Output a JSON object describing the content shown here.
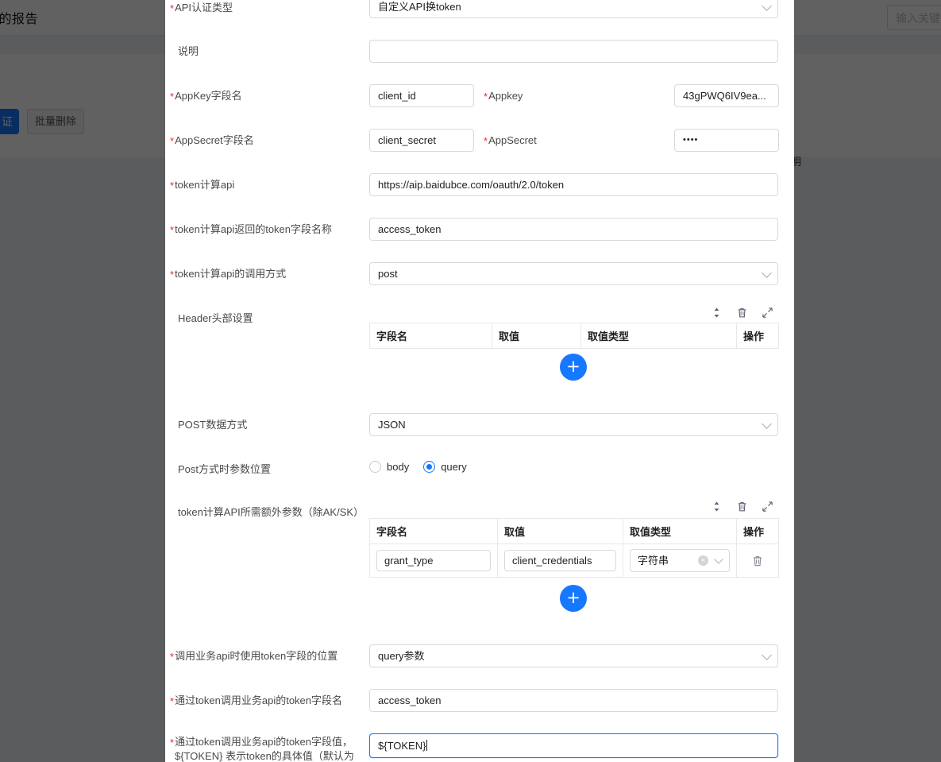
{
  "background": {
    "page_title": "我的报告",
    "search_placeholder": "输入关键词",
    "primary_button": "证",
    "secondary_button": "批量删除",
    "right_text": "明"
  },
  "modal": {
    "fields": [
      {
        "label": "API认证类型",
        "required": true,
        "type": "select",
        "value": "自定义API换token"
      },
      {
        "label": "说明",
        "required": false,
        "type": "input",
        "value": ""
      },
      {
        "label": "AppKey字段名",
        "required": true,
        "type": "input-pair",
        "value": "client_id",
        "label2": "Appkey",
        "required2": true,
        "value2": "43gPWQ6IV9ea..."
      },
      {
        "label": "AppSecret字段名",
        "required": true,
        "type": "input-pair",
        "value": "client_secret",
        "label2": "AppSecret",
        "required2": true,
        "value2": "••••"
      },
      {
        "label": "token计算api",
        "required": true,
        "type": "input",
        "value": "https://aip.baidubce.com/oauth/2.0/token"
      },
      {
        "label": "token计算api返回的token字段名称",
        "required": true,
        "type": "input",
        "value": "access_token"
      },
      {
        "label": "token计算api的调用方式",
        "required": true,
        "type": "select",
        "value": "post"
      }
    ],
    "header_table": {
      "label": "Header头部设置",
      "required": false,
      "columns": [
        "字段名",
        "取值",
        "取值类型",
        "操作"
      ],
      "rows": [],
      "add_label": "+",
      "tools": [
        "sort-icon",
        "trash-icon",
        "expand-icon"
      ]
    },
    "post_data_mode": {
      "label": "POST数据方式",
      "required": false,
      "value": "JSON"
    },
    "post_param_position": {
      "label": "Post方式时参数位置",
      "required": false,
      "options": [
        "body",
        "query"
      ],
      "selected": "query"
    },
    "extra_params_table": {
      "label": "token计算API所需额外参数（除AK/SK）",
      "required": false,
      "columns": [
        "字段名",
        "取值",
        "取值类型",
        "操作"
      ],
      "rows": [
        {
          "field_name": "grant_type",
          "value": "client_credentials",
          "value_type": "字符串"
        }
      ],
      "add_label": "+",
      "tools": [
        "sort-icon",
        "trash-icon",
        "expand-icon"
      ]
    },
    "bottom_fields": [
      {
        "label": "调用业务api时使用token字段的位置",
        "required": true,
        "type": "select",
        "value": "query参数"
      },
      {
        "label": "通过token调用业务api的token字段名",
        "required": true,
        "type": "input",
        "value": "access_token"
      },
      {
        "label": "通过token调用业务api的token字段值，",
        "label_line2": "${TOKEN} 表示token的具体值（默认为",
        "required": true,
        "type": "input",
        "value": "${TOKEN}",
        "focused": true
      }
    ]
  },
  "colors": {
    "primary": "#1677ff",
    "required_star": "#f5222d",
    "border": "#d9d9d9",
    "table_border": "#e8e8e8",
    "scrim": "rgba(0,0,0,0.62)"
  }
}
